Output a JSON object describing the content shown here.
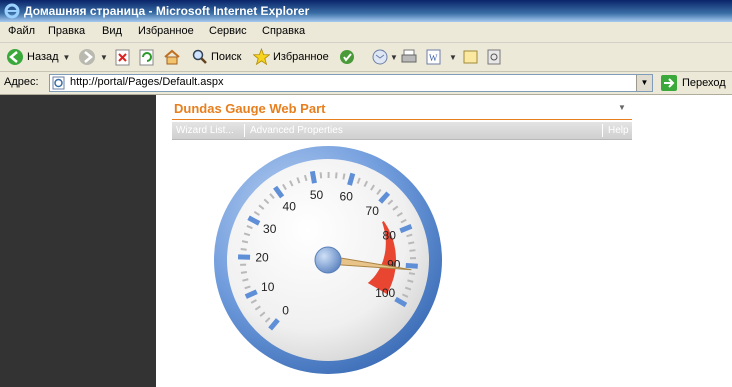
{
  "window": {
    "title": "Домашняя страница - Microsoft Internet Explorer"
  },
  "menu": [
    "Файл",
    "Правка",
    "Вид",
    "Избранное",
    "Сервис",
    "Справка"
  ],
  "toolbar": {
    "back_label": "Назад",
    "search_label": "Поиск",
    "favorites_label": "Избранное"
  },
  "address": {
    "label": "Адрес:",
    "url": "http://portal/Pages/Default.aspx",
    "go_label": "Переход"
  },
  "webpart": {
    "title": "Dundas Gauge Web Part",
    "toolbar": [
      "Wizard List...",
      "Advanced Properties",
      "Help"
    ]
  },
  "gauge": {
    "min": 0,
    "max": 100,
    "value": 91,
    "tick_labels": [
      "0",
      "10",
      "20",
      "30",
      "40",
      "50",
      "60",
      "70",
      "80",
      "90",
      "100"
    ],
    "range_start": 75,
    "range_end": 100,
    "range_color": "#e8331c",
    "frame_color": "#5f8fd6",
    "needle_color": "#e8c48a",
    "cap_color": "#7aa2dc"
  }
}
